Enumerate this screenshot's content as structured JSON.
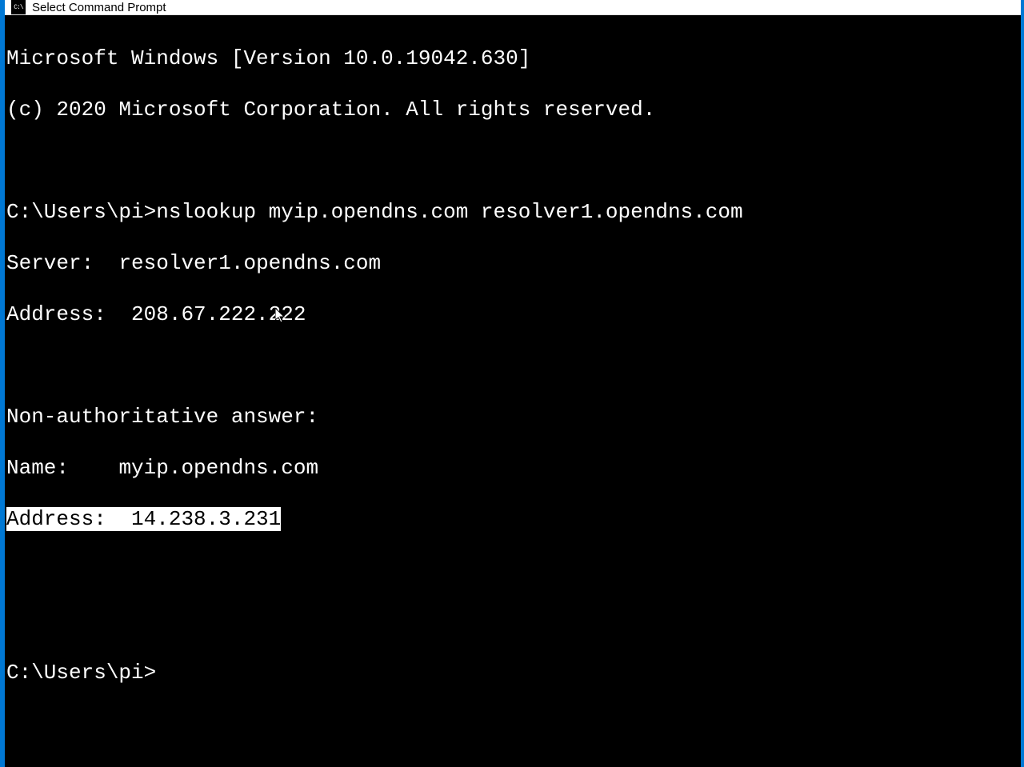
{
  "window": {
    "title": "Select Command Prompt",
    "icon_label": "cmd-icon"
  },
  "terminal": {
    "banner_line1": "Microsoft Windows [Version 10.0.19042.630]",
    "banner_line2": "(c) 2020 Microsoft Corporation. All rights reserved.",
    "prompt1": "C:\\Users\\pi>",
    "command1": "nslookup myip.opendns.com resolver1.opendns.com",
    "server_label": "Server:  ",
    "server_value": "resolver1.opendns.com",
    "address_label": "Address:  ",
    "address_value": "208.67.222.222",
    "non_auth": "Non-authoritative answer:",
    "name_label": "Name:    ",
    "name_value": "myip.opendns.com",
    "result_address_label": "Address:  ",
    "result_address_value": "14.238.3.231",
    "prompt2": "C:\\Users\\pi>"
  }
}
